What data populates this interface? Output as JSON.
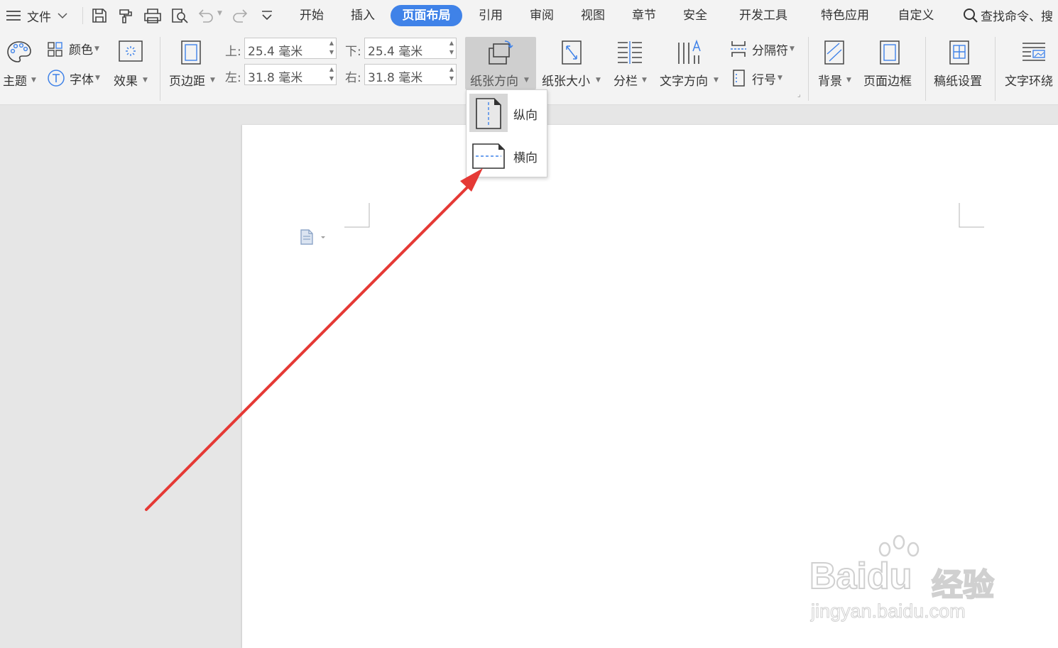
{
  "menu": {
    "file_label": "文件",
    "tabs": [
      "开始",
      "插入",
      "页面布局",
      "引用",
      "审阅",
      "视图",
      "章节",
      "安全",
      "开发工具",
      "特色应用",
      "自定义"
    ],
    "active_tab": "页面布局",
    "search_placeholder": "查找命令、搜"
  },
  "ribbon": {
    "theme_label": "主题",
    "color_label": "颜色",
    "font_label": "字体",
    "effect_label": "效果",
    "margins_label": "页边距",
    "margin_top_label": "上:",
    "margin_top_value": "25.4 毫米",
    "margin_bottom_label": "下:",
    "margin_bottom_value": "25.4 毫米",
    "margin_left_label": "左:",
    "margin_left_value": "31.8 毫米",
    "margin_right_label": "右:",
    "margin_right_value": "31.8 毫米",
    "orientation_label": "纸张方向",
    "paper_size_label": "纸张大小",
    "columns_label": "分栏",
    "text_direction_label": "文字方向",
    "breaks_label": "分隔符",
    "line_numbers_label": "行号",
    "background_label": "背景",
    "page_border_label": "页面边框",
    "manuscript_label": "稿纸设置",
    "text_wrap_label": "文字环绕"
  },
  "orientation_menu": {
    "portrait_label": "纵向",
    "landscape_label": "横向",
    "selected": "portrait"
  },
  "watermark": {
    "brand": "Baidu",
    "brand_cn": "经验",
    "url": "jingyan.baidu.com"
  },
  "colors": {
    "accent": "#3f82e8",
    "ribbon_bg": "#f3f3f3",
    "canvas_bg": "#e6e6e6",
    "arrow": "#e53935"
  }
}
